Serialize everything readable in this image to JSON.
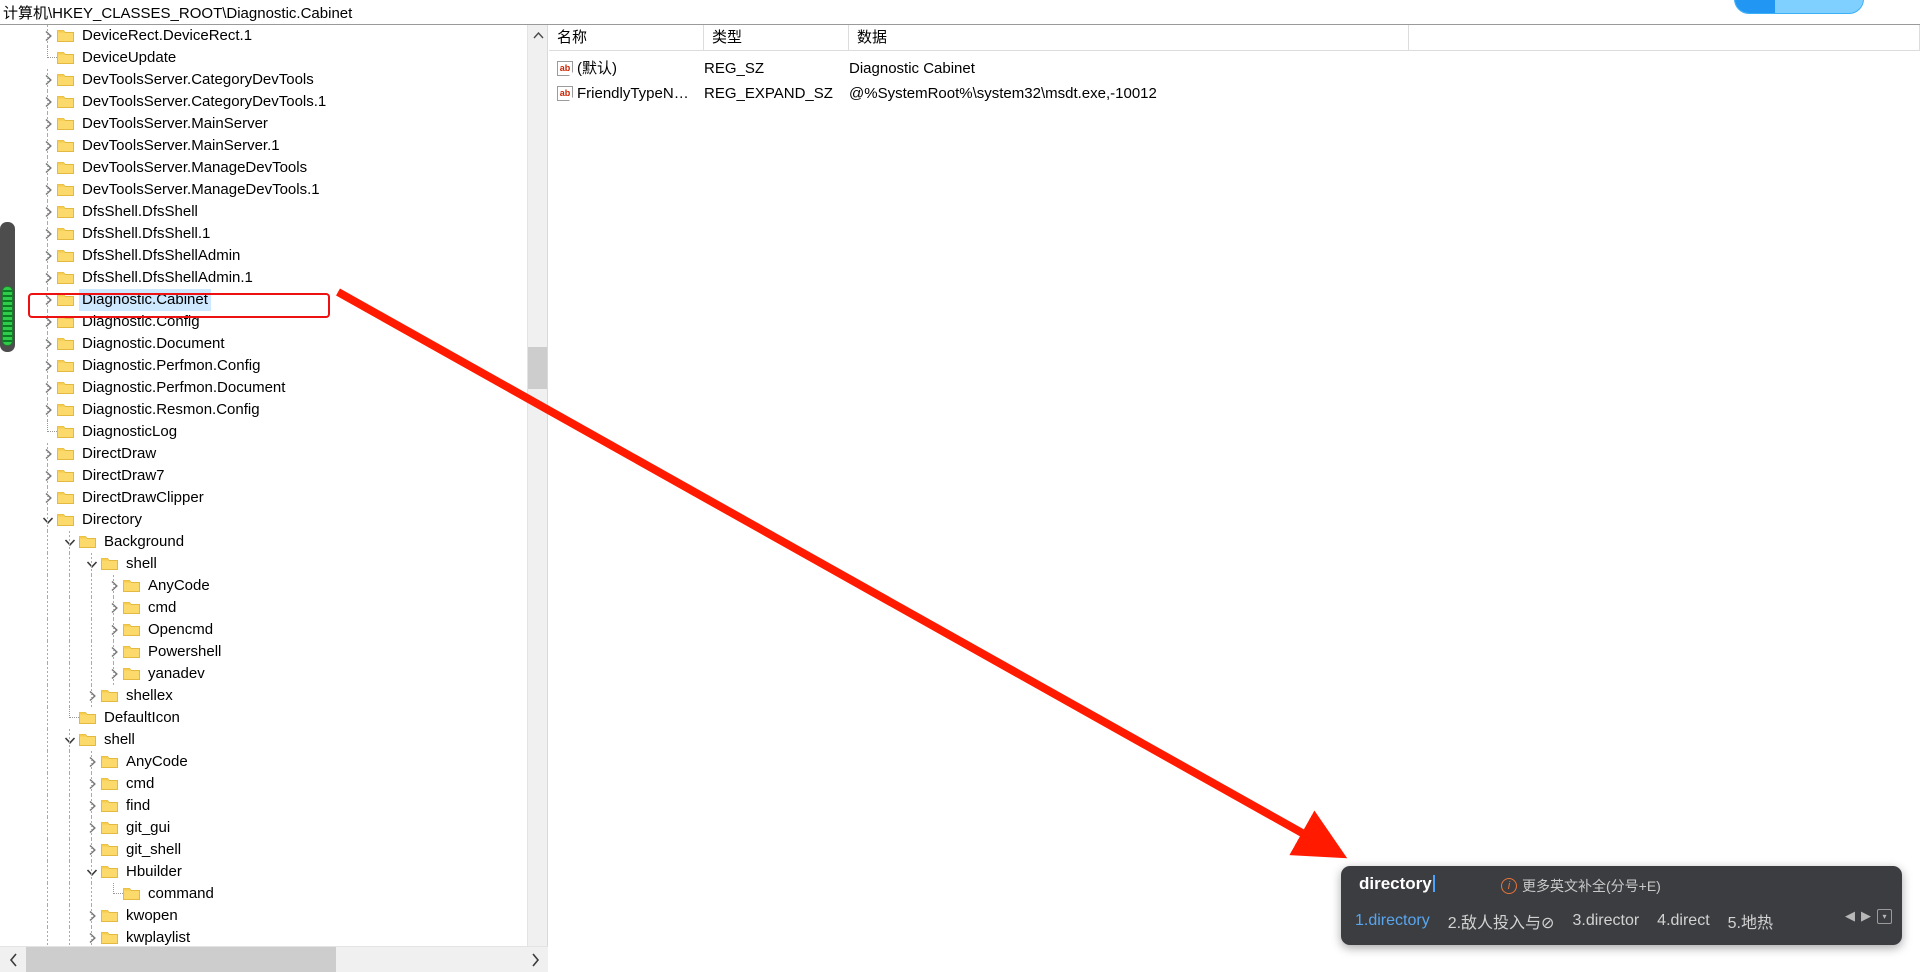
{
  "addressbar": {
    "path": "计算机\\HKEY_CLASSES_ROOT\\Diagnostic.Cabinet"
  },
  "top_pill": {
    "text": ""
  },
  "tree": {
    "nodes": [
      {
        "label": "DeviceRect.DeviceRect.1",
        "depth": 1,
        "twisty": "collapsed",
        "selected": false
      },
      {
        "label": "DeviceUpdate",
        "depth": 1,
        "twisty": "leaf",
        "selected": false
      },
      {
        "label": "DevToolsServer.CategoryDevTools",
        "depth": 1,
        "twisty": "collapsed",
        "selected": false
      },
      {
        "label": "DevToolsServer.CategoryDevTools.1",
        "depth": 1,
        "twisty": "collapsed",
        "selected": false
      },
      {
        "label": "DevToolsServer.MainServer",
        "depth": 1,
        "twisty": "collapsed",
        "selected": false
      },
      {
        "label": "DevToolsServer.MainServer.1",
        "depth": 1,
        "twisty": "collapsed",
        "selected": false
      },
      {
        "label": "DevToolsServer.ManageDevTools",
        "depth": 1,
        "twisty": "collapsed",
        "selected": false
      },
      {
        "label": "DevToolsServer.ManageDevTools.1",
        "depth": 1,
        "twisty": "collapsed",
        "selected": false
      },
      {
        "label": "DfsShell.DfsShell",
        "depth": 1,
        "twisty": "collapsed",
        "selected": false
      },
      {
        "label": "DfsShell.DfsShell.1",
        "depth": 1,
        "twisty": "collapsed",
        "selected": false
      },
      {
        "label": "DfsShell.DfsShellAdmin",
        "depth": 1,
        "twisty": "collapsed",
        "selected": false
      },
      {
        "label": "DfsShell.DfsShellAdmin.1",
        "depth": 1,
        "twisty": "collapsed",
        "selected": false
      },
      {
        "label": "Diagnostic.Cabinet",
        "depth": 1,
        "twisty": "collapsed",
        "selected": true
      },
      {
        "label": "Diagnostic.Config",
        "depth": 1,
        "twisty": "collapsed",
        "selected": false
      },
      {
        "label": "Diagnostic.Document",
        "depth": 1,
        "twisty": "collapsed",
        "selected": false
      },
      {
        "label": "Diagnostic.Perfmon.Config",
        "depth": 1,
        "twisty": "collapsed",
        "selected": false
      },
      {
        "label": "Diagnostic.Perfmon.Document",
        "depth": 1,
        "twisty": "collapsed",
        "selected": false
      },
      {
        "label": "Diagnostic.Resmon.Config",
        "depth": 1,
        "twisty": "collapsed",
        "selected": false
      },
      {
        "label": "DiagnosticLog",
        "depth": 1,
        "twisty": "leaf",
        "selected": false
      },
      {
        "label": "DirectDraw",
        "depth": 1,
        "twisty": "collapsed",
        "selected": false
      },
      {
        "label": "DirectDraw7",
        "depth": 1,
        "twisty": "collapsed",
        "selected": false
      },
      {
        "label": "DirectDrawClipper",
        "depth": 1,
        "twisty": "collapsed",
        "selected": false
      },
      {
        "label": "Directory",
        "depth": 1,
        "twisty": "expanded",
        "selected": false
      },
      {
        "label": "Background",
        "depth": 2,
        "twisty": "expanded",
        "selected": false
      },
      {
        "label": "shell",
        "depth": 3,
        "twisty": "expanded",
        "selected": false
      },
      {
        "label": "AnyCode",
        "depth": 4,
        "twisty": "collapsed",
        "selected": false
      },
      {
        "label": "cmd",
        "depth": 4,
        "twisty": "collapsed",
        "selected": false
      },
      {
        "label": "Opencmd",
        "depth": 4,
        "twisty": "collapsed",
        "selected": false
      },
      {
        "label": "Powershell",
        "depth": 4,
        "twisty": "collapsed",
        "selected": false
      },
      {
        "label": "yanadev",
        "depth": 4,
        "twisty": "collapsed",
        "selected": false
      },
      {
        "label": "shellex",
        "depth": 3,
        "twisty": "collapsed",
        "selected": false
      },
      {
        "label": "DefaultIcon",
        "depth": 2,
        "twisty": "leaf",
        "selected": false
      },
      {
        "label": "shell",
        "depth": 2,
        "twisty": "expanded",
        "selected": false
      },
      {
        "label": "AnyCode",
        "depth": 3,
        "twisty": "collapsed",
        "selected": false
      },
      {
        "label": "cmd",
        "depth": 3,
        "twisty": "collapsed",
        "selected": false
      },
      {
        "label": "find",
        "depth": 3,
        "twisty": "collapsed",
        "selected": false
      },
      {
        "label": "git_gui",
        "depth": 3,
        "twisty": "collapsed",
        "selected": false
      },
      {
        "label": "git_shell",
        "depth": 3,
        "twisty": "collapsed",
        "selected": false
      },
      {
        "label": "Hbuilder",
        "depth": 3,
        "twisty": "expanded",
        "selected": false
      },
      {
        "label": "command",
        "depth": 4,
        "twisty": "leaf",
        "selected": false
      },
      {
        "label": "kwopen",
        "depth": 3,
        "twisty": "collapsed",
        "selected": false
      },
      {
        "label": "kwplaylist",
        "depth": 3,
        "twisty": "collapsed",
        "selected": false
      }
    ]
  },
  "values": {
    "columns": [
      {
        "key": "name",
        "label": "名称"
      },
      {
        "key": "type",
        "label": "类型"
      },
      {
        "key": "data",
        "label": "数据"
      }
    ],
    "rows": [
      {
        "icon": "ab",
        "name": "(默认)",
        "type": "REG_SZ",
        "data": "Diagnostic Cabinet"
      },
      {
        "icon": "ab",
        "name": "FriendlyTypeN…",
        "type": "REG_EXPAND_SZ",
        "data": "@%SystemRoot%\\system32\\msdt.exe,-10012"
      }
    ]
  },
  "ime": {
    "composing": "directory",
    "hint": "更多英文补全(分号+E)",
    "candidates": [
      "1.directory",
      "2.敌人投入与⊘",
      "3.director",
      "4.direct",
      "5.地热"
    ],
    "prev_label": "◀",
    "next_label": "▶",
    "expand_label": "▾"
  },
  "scrollbars": {
    "tree_up_arrow": "⌃",
    "tree_left_arrow": "❮",
    "tree_right_arrow": "❯"
  },
  "colors": {
    "selection": "#cde8ff",
    "annotation_red": "#ee1111",
    "folder_yellow": "#fbd96a",
    "ime_background": "#3b3d40",
    "ime_accent": "#59a6ef"
  }
}
